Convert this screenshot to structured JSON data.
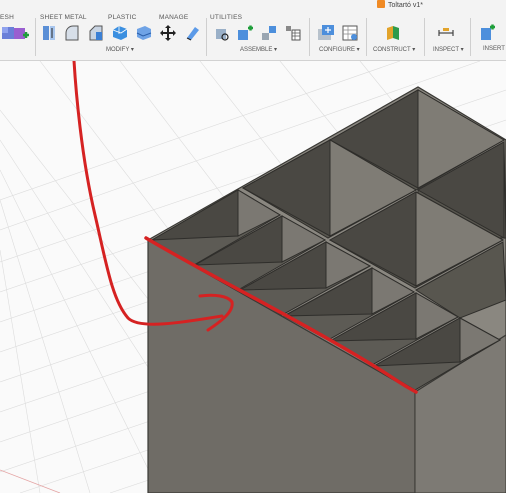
{
  "window": {
    "title": "Toltartó v1*"
  },
  "tabs": [
    {
      "label": "ESH"
    },
    {
      "label": "SHEET METAL"
    },
    {
      "label": "PLASTIC"
    },
    {
      "label": "MANAGE"
    },
    {
      "label": "UTILITIES"
    }
  ],
  "groups": [
    {
      "label": "MODIFY ▾"
    },
    {
      "label": "ASSEMBLE ▾"
    },
    {
      "label": "CONFIGURE ▾"
    },
    {
      "label": "CONSTRUCT ▾"
    },
    {
      "label": "INSPECT ▾"
    },
    {
      "label": "INSERT"
    }
  ],
  "tools": [
    {
      "icon": "mesh-icon"
    },
    {
      "icon": "split-body-icon"
    },
    {
      "icon": "fillet-icon"
    },
    {
      "icon": "chamfer-icon"
    },
    {
      "icon": "shell-icon"
    },
    {
      "icon": "combine-icon"
    },
    {
      "icon": "move-icon"
    },
    {
      "icon": "scale-icon"
    },
    {
      "icon": "new-component-icon"
    },
    {
      "icon": "joint-icon"
    },
    {
      "icon": "as-built-joint-icon"
    },
    {
      "icon": "rigid-group-icon"
    },
    {
      "icon": "configure-icon"
    },
    {
      "icon": "table-icon"
    },
    {
      "icon": "offset-plane-icon"
    },
    {
      "icon": "measure-icon"
    },
    {
      "icon": "insert-icon"
    }
  ],
  "colors": {
    "accent": "#2f7fd6",
    "annotation": "#d52222",
    "model": "#6f6c66"
  }
}
